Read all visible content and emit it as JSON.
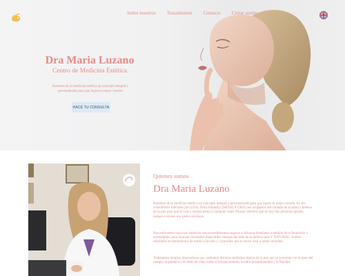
{
  "nav": {
    "items": [
      "Sobre nosotros",
      "Tratamientos",
      "Contacto",
      "Cerrar sesión"
    ]
  },
  "language_flag": "uk-flag-icon",
  "hero": {
    "title": "Dra Maria Luzano",
    "subtitle": "Centro de Medicina Estética",
    "description": "Haremos de la medicina estética un concepto integral y personalizado para que logres tu mejor versión",
    "cta_label": "HACÉ TU CONSULTA"
  },
  "about": {
    "kicker": "Quienes somos",
    "title": "Dra Maria Luzano",
    "paragraphs": [
      "Haremos de la medicina estética un concepto integral y personalizado para que logres tu mejor versión. En los consultorios liderados por la Dra. Erica Polansky (MEDICA UBA) nos ocupamos del cuidado de la salud y belleza de tu piel para que te veas y sientas plena a cualquier edad. Porque sabemos que no hay dos personas iguales, tampoco existen dos pieles similares.",
      "Nos enfocamos hacia tus objetivos con procedimientos seguros y eficaces diseñados a medida de tu fisonomía y necesidades, para alcanzar resultados impecables siempre del lado de la belleza sana Y NATURAL. Somos referentes en tratamientos de estética faciales y corporales que te hacen lucir y sentir increíble.",
      "Trabajamos terapias innovadoras que combaten distintos molestias típicas de la piel que se acentúan con el paso del tiempo, la genética y el ritmo de vida, como el envejecimiento, la falta de luminosidad y la flacidez."
    ]
  },
  "colors": {
    "accent": "#e58a86",
    "cta_bg": "#dde9f6",
    "cta_text": "#3b4a66"
  }
}
